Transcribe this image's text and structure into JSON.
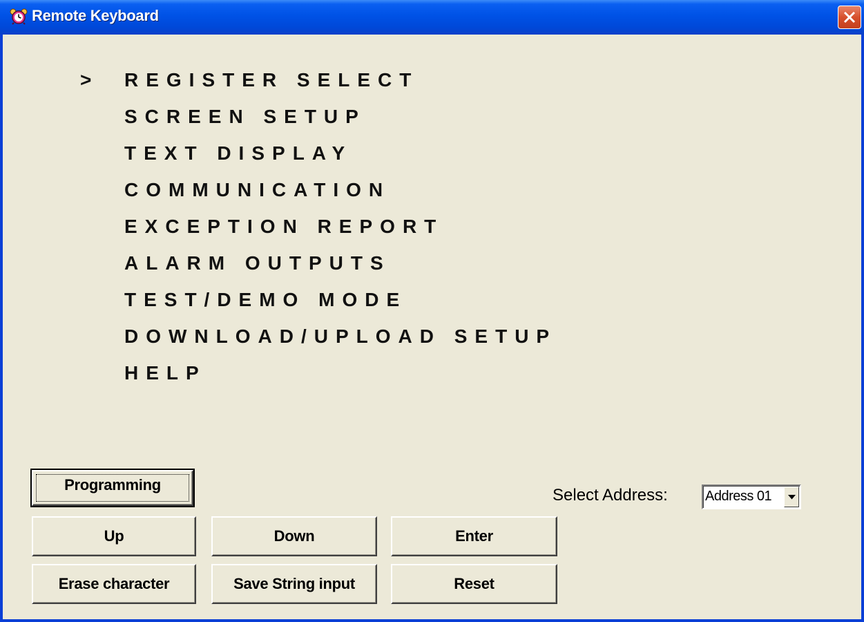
{
  "window": {
    "title": "Remote Keyboard"
  },
  "menu": {
    "cursor": ">",
    "selected_index": 0,
    "items": [
      "REGISTER SELECT",
      "SCREEN SETUP",
      "TEXT DISPLAY",
      "COMMUNICATION",
      "EXCEPTION REPORT",
      "ALARM OUTPUTS",
      "TEST/DEMO MODE",
      "DOWNLOAD/UPLOAD SETUP",
      "HELP"
    ]
  },
  "buttons": {
    "programming": "Programming",
    "up": "Up",
    "down": "Down",
    "enter": "Enter",
    "erase": "Erase character",
    "save": "Save String input",
    "reset": "Reset"
  },
  "address": {
    "label": "Select Address:",
    "value": "Address 01"
  },
  "colors": {
    "titlebar": "#0052e6",
    "background": "#ece9d8",
    "close": "#d7502c"
  },
  "icons": {
    "app": "alarm-clock-icon",
    "close": "close-icon",
    "dropdown": "chevron-down-icon"
  }
}
